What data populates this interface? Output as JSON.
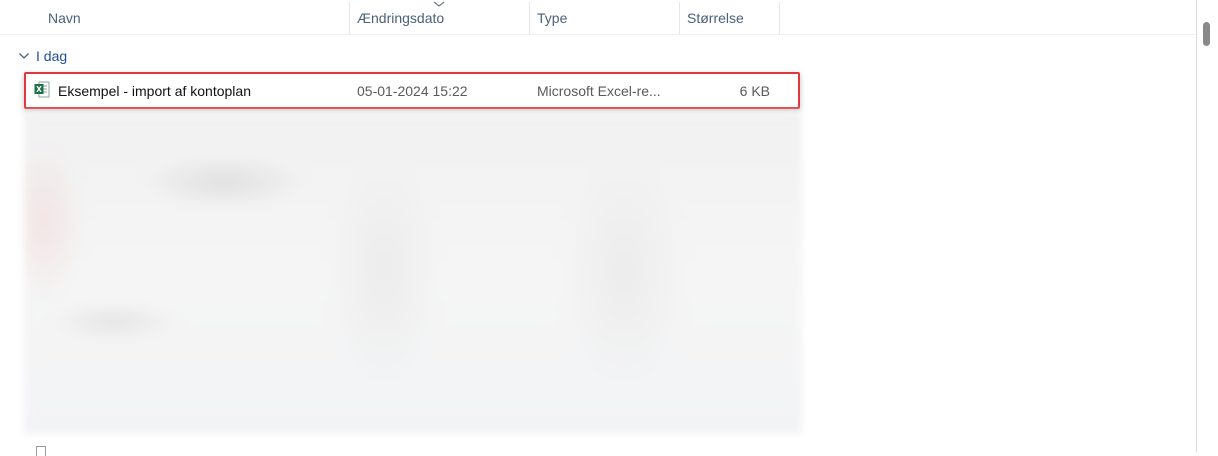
{
  "columns": {
    "name": "Navn",
    "date": "Ændringsdato",
    "type": "Type",
    "size": "Størrelse"
  },
  "group": {
    "label": "I dag"
  },
  "file": {
    "name": "Eksempel - import af kontoplan",
    "date": "05-01-2024 15:22",
    "type": "Microsoft Excel-re...",
    "size": "6 KB",
    "icon": "excel-file-icon"
  },
  "colors": {
    "highlight_border": "#e0373e",
    "header_text": "#4c607a",
    "group_text": "#1f4e9b",
    "excel_green": "#1d7044"
  }
}
